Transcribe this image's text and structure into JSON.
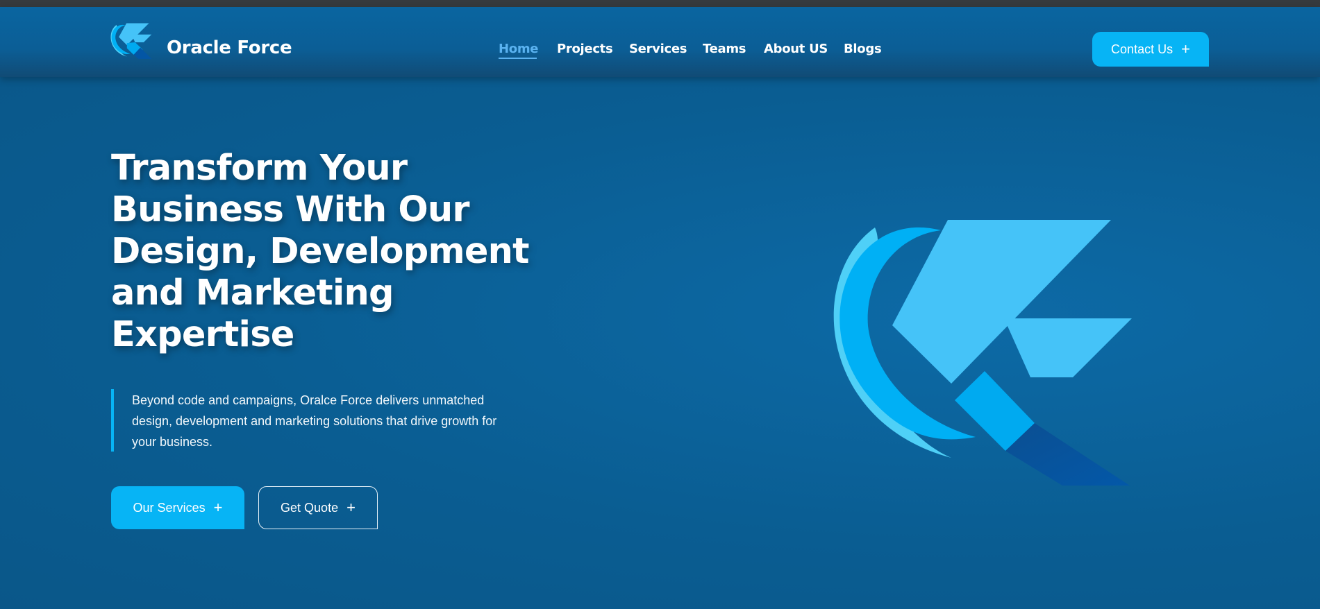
{
  "brand": {
    "name": "Oracle Force",
    "logo_icon": "oracle-force-logo-icon"
  },
  "nav": {
    "items": [
      {
        "label": "Home",
        "active": true
      },
      {
        "label": "Projects",
        "active": false
      },
      {
        "label": "Services",
        "active": false
      },
      {
        "label": "Teams",
        "active": false
      },
      {
        "label": "About US",
        "active": false
      },
      {
        "label": "Blogs",
        "active": false
      }
    ],
    "contact_label": "Contact Us",
    "plus_icon": "+"
  },
  "hero": {
    "headline": "Transform Your\nBusiness With Our\nDesign, Development\nand Marketing\nExpertise",
    "description": "Beyond code and campaigns, Oralce Force delivers unmatched\ndesign, development and marketing solutions that drive growth for\nyour business.",
    "primary_button": "Our Services",
    "secondary_button": "Get Quote",
    "plus_icon": "+"
  },
  "colors": {
    "accent": "#07b4f5",
    "background": "#0a5d92",
    "nav_active": "#5ab2f0"
  }
}
